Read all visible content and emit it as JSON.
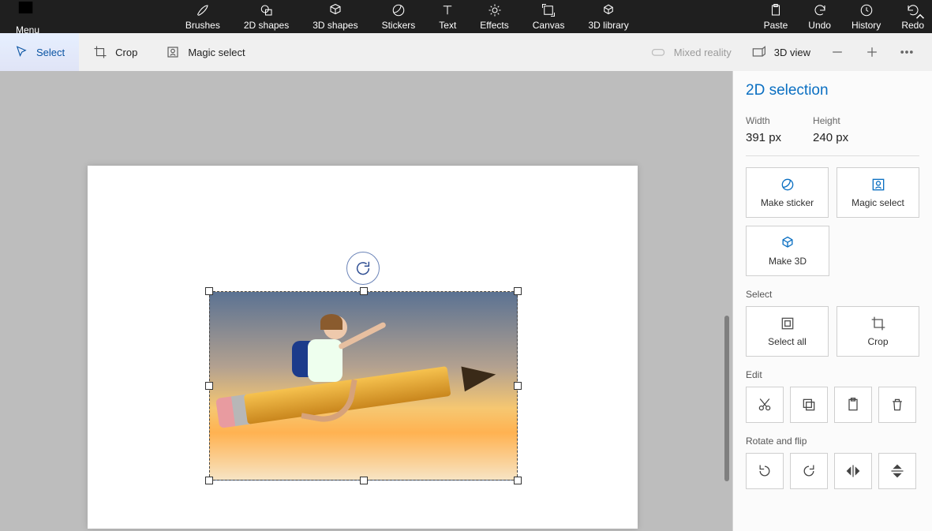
{
  "ribbon": {
    "menu": "Menu",
    "tabs": {
      "brushes": "Brushes",
      "shapes2d": "2D shapes",
      "shapes3d": "3D shapes",
      "stickers": "Stickers",
      "text": "Text",
      "effects": "Effects",
      "canvas": "Canvas",
      "library3d": "3D library"
    },
    "actions": {
      "paste": "Paste",
      "undo": "Undo",
      "history": "History",
      "redo": "Redo"
    }
  },
  "toolbar": {
    "select": "Select",
    "crop": "Crop",
    "magic_select": "Magic select",
    "mixed_reality": "Mixed reality",
    "view3d": "3D view"
  },
  "panel": {
    "title": "2D selection",
    "width_label": "Width",
    "width_value": "391 px",
    "height_label": "Height",
    "height_value": "240 px",
    "make_sticker": "Make sticker",
    "magic_select": "Magic select",
    "make_3d": "Make 3D",
    "select_section": "Select",
    "select_all": "Select all",
    "crop": "Crop",
    "edit_section": "Edit",
    "rotate_section": "Rotate and flip"
  }
}
